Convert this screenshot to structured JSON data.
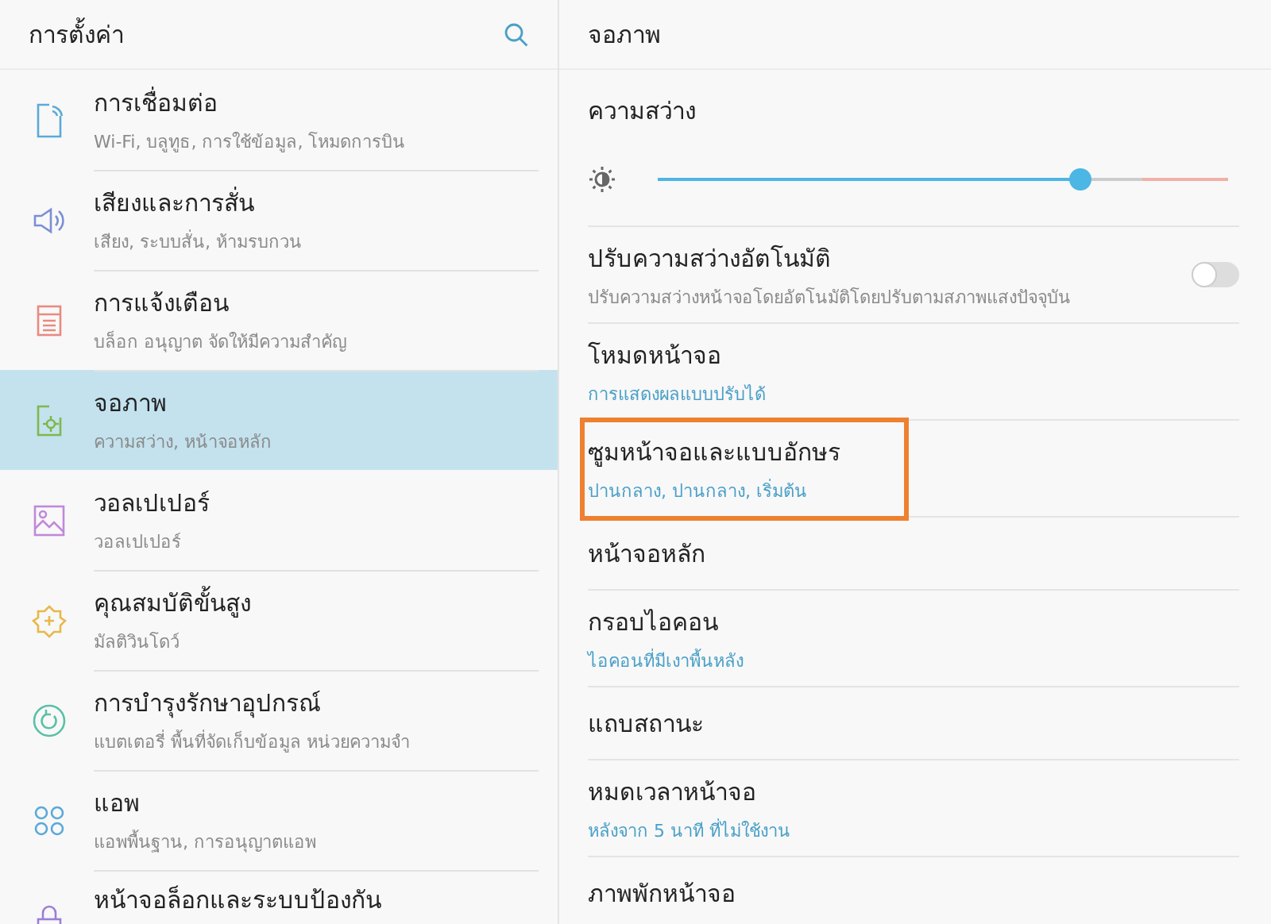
{
  "sidebar": {
    "title": "การตั้งค่า",
    "items": [
      {
        "title": "การเชื่อมต่อ",
        "subtitle": "Wi-Fi, บลูทูธ, การใช้ข้อมูล, โหมดการบิน",
        "selected": false
      },
      {
        "title": "เสียงและการสั่น",
        "subtitle": "เสียง, ระบบสั่น, ห้ามรบกวน",
        "selected": false
      },
      {
        "title": "การแจ้งเตือน",
        "subtitle": "บล็อก อนุญาต จัดให้มีความสำคัญ",
        "selected": false
      },
      {
        "title": "จอภาพ",
        "subtitle": "ความสว่าง, หน้าจอหลัก",
        "selected": true
      },
      {
        "title": "วอลเปเปอร์",
        "subtitle": "วอลเปเปอร์",
        "selected": false
      },
      {
        "title": "คุณสมบัติขั้นสูง",
        "subtitle": "มัลติวินโดว์",
        "selected": false
      },
      {
        "title": "การบำรุงรักษาอุปกรณ์",
        "subtitle": "แบตเตอรี่ พื้นที่จัดเก็บข้อมูล หน่วยความจำ",
        "selected": false
      },
      {
        "title": "แอพ",
        "subtitle": "แอพพื้นฐาน, การอนุญาตแอพ",
        "selected": false
      },
      {
        "title": "หน้าจอล็อกและระบบป้องกัน",
        "selected": false
      }
    ]
  },
  "detail": {
    "title": "จอภาพ",
    "items": [
      {
        "kind": "slider",
        "title": "ความสว่าง",
        "level": 0.74
      },
      {
        "kind": "toggle",
        "title": "ปรับความสว่างอัตโนมัติ",
        "subtitle": "ปรับความสว่างหน้าจอโดยอัตโนมัติโดยปรับตามสภาพแสงปัจจุบัน",
        "on": false
      },
      {
        "kind": "value",
        "title": "โหมดหน้าจอ",
        "subtitle": "การแสดงผลแบบปรับได้",
        "highlighted": false
      },
      {
        "kind": "value",
        "title": "ซูมหน้าจอและแบบอักษร",
        "subtitle": "ปานกลาง, ปานกลาง, เริ่มต้น",
        "highlighted": true
      },
      {
        "kind": "value",
        "title": "หน้าจอหลัก",
        "highlighted": false
      },
      {
        "kind": "value",
        "title": "กรอบไอคอน",
        "subtitle": "ไอคอนที่มีเงาพื้นหลัง",
        "highlighted": false
      },
      {
        "kind": "value",
        "title": "แถบสถานะ",
        "highlighted": false
      },
      {
        "kind": "value",
        "title": "หมดเวลาหน้าจอ",
        "subtitle": "หลังจาก 5 นาที ที่ไม่ใช้งาน",
        "highlighted": false
      },
      {
        "kind": "value",
        "title": "ภาพพักหน้าจอ",
        "highlighted": false
      }
    ]
  }
}
